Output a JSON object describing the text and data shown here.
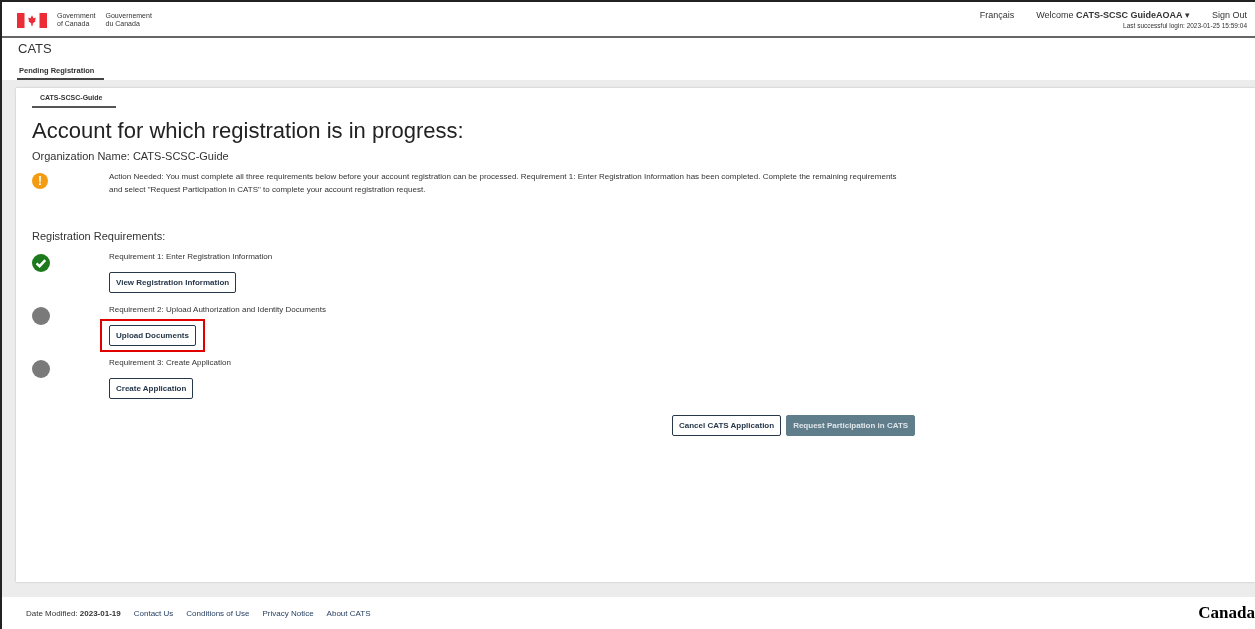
{
  "header": {
    "gov_en": [
      "Government",
      "of Canada"
    ],
    "gov_fr": [
      "Gouvernement",
      "du Canada"
    ],
    "language_link": "Français",
    "welcome": "Welcome",
    "user": "CATS-SCSC GuideAOAA",
    "user_caret": "▾",
    "sign_out": "Sign Out",
    "last_login": "Last successful login: 2023-01-25 15:59:04"
  },
  "app_title": "CATS",
  "tabs": [
    {
      "label": "Pending Registration",
      "selected": true
    }
  ],
  "inner_tabs": [
    {
      "label": "CATS-SCSC-Guide",
      "selected": true
    }
  ],
  "heading": "Account for which registration is in progress:",
  "organization": "Organization Name: CATS-SCSC-Guide",
  "alert": {
    "kind": "warning",
    "glyph": "!",
    "text": "Action Needed: You must complete all three requirements below before your account registration can be processed. Requirement 1: Enter Registration Information has been completed. Complete the remaining requirements and select \"Request Participation in CATS\" to complete your account registration request."
  },
  "requirements_title": "Registration Requirements:",
  "requirements": [
    {
      "label": "Requirement 1: Enter Registration Information",
      "completed": true,
      "button": "View Registration Information",
      "highlighted": false
    },
    {
      "label": "Requirement 2: Upload Authorization and Identity Documents",
      "completed": false,
      "button": "Upload Documents",
      "highlighted": true
    },
    {
      "label": "Requirement 3: Create Application",
      "completed": false,
      "button": "Create Application",
      "highlighted": false
    }
  ],
  "actions": [
    {
      "label": "Cancel CATS Application",
      "kind": "secondary",
      "disabled": false
    },
    {
      "label": "Request Participation in CATS",
      "kind": "primary",
      "disabled": true
    }
  ],
  "footer": {
    "modified_label": "Date Modified:",
    "modified_date": "2023-01-19",
    "links": [
      "Contact Us",
      "Conditions of Use",
      "Privacy Notice",
      "About CATS"
    ],
    "wordmark": "Canada"
  }
}
